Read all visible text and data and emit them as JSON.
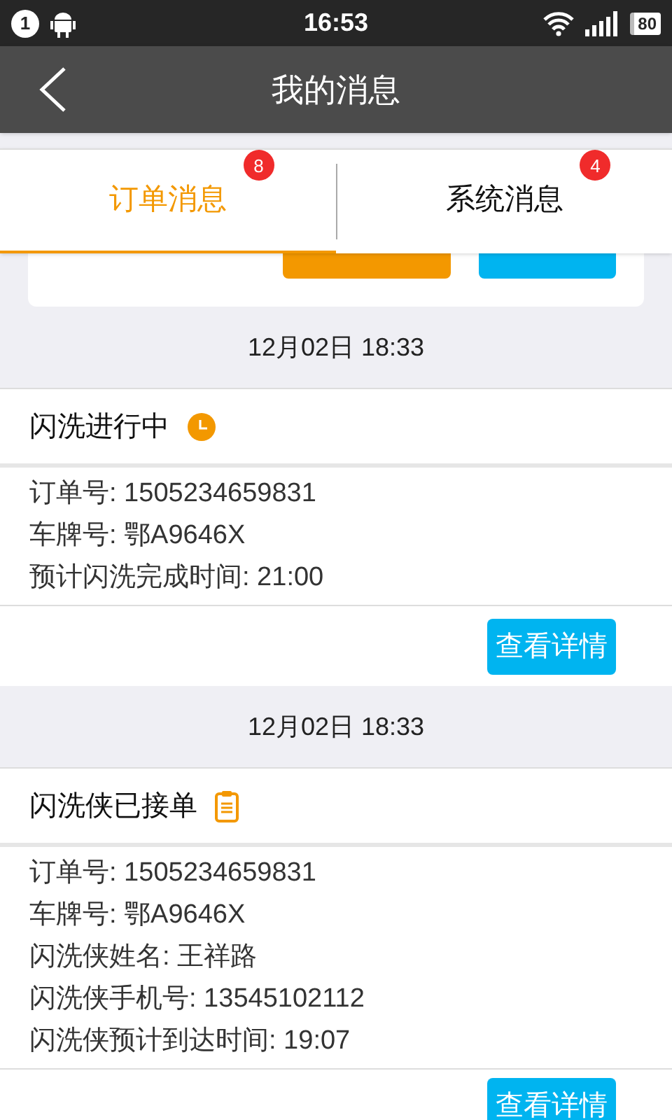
{
  "status_bar": {
    "notification_count": "1",
    "time": "16:53",
    "battery": "80"
  },
  "header": {
    "title": "我的消息"
  },
  "tabs": [
    {
      "label": "订单消息",
      "badge": "8",
      "selected": true
    },
    {
      "label": "系统消息",
      "badge": "4",
      "selected": false
    }
  ],
  "messages": [
    {
      "date": "12月02日 18:33",
      "title": "闪洗进行中",
      "kind": "in_progress",
      "details": [
        "订单号: 1505234659831",
        "车牌号: 鄂A9646X",
        "预计闪洗完成时间: 21:00"
      ],
      "button": "查看详情"
    },
    {
      "date": "12月02日 18:33",
      "title": "闪洗侠已接单",
      "kind": "accepted",
      "details": [
        "订单号: 1505234659831",
        "车牌号: 鄂A9646X",
        "闪洗侠姓名: 王祥路",
        "闪洗侠手机号: 13545102112",
        "闪洗侠预计到达时间: 19:07"
      ],
      "button": "查看详情"
    }
  ]
}
